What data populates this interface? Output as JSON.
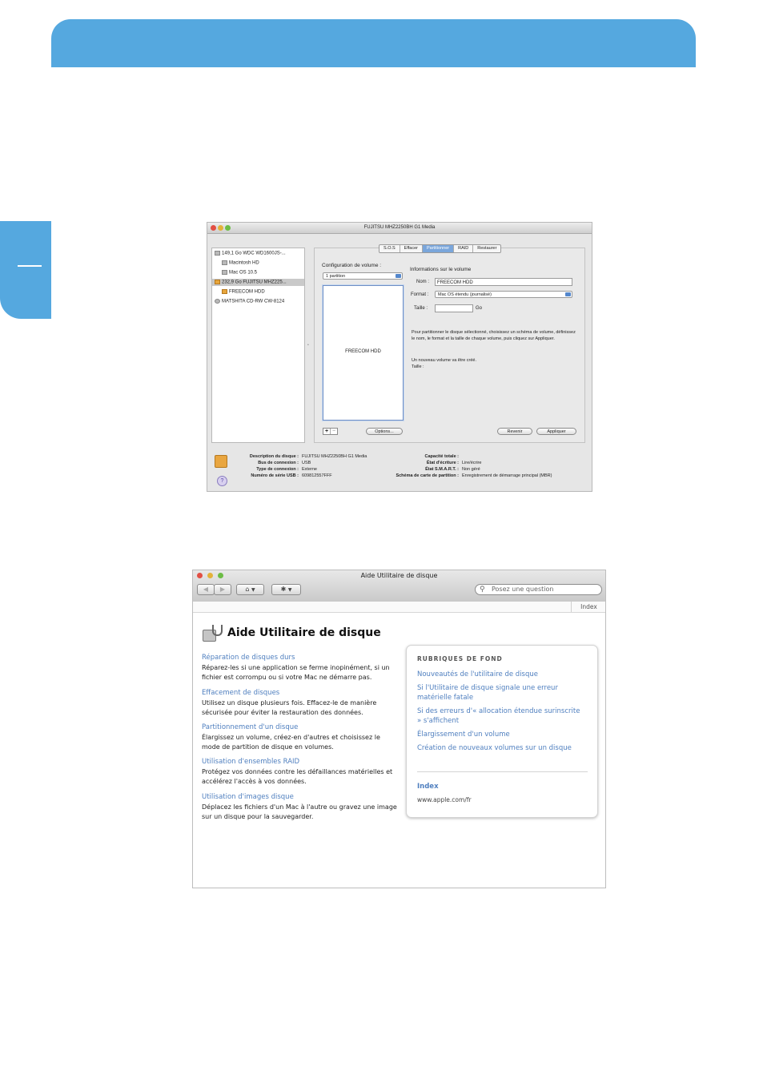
{
  "disk_utility": {
    "title": "FUJITSU MHZ2250BH G1 Media",
    "sidebar": [
      "149,1 Go WDC WD1600JS-...",
      "Macintosh HD",
      "Mac OS 10.5",
      "232,9 Go FUJITSU MHZ225...",
      "FREECOM HDD",
      "MATSHITA CD-RW CW-8124"
    ],
    "tabs": [
      "S.O.S",
      "Effacer",
      "Partitionner",
      "RAID",
      "Restaurer"
    ],
    "config_label": "Configuration de volume :",
    "config_value": "1 partition",
    "volume_name": "FREECOM HDD",
    "info_label": "Informations sur le volume",
    "name_label": "Nom :",
    "name_value": "FREECOM HDD",
    "format_label": "Format :",
    "format_value": "Mac OS étendu (journalisé)",
    "size_label": "Taille :",
    "size_unit": "Go",
    "help_text_1": "Pour partitionner le disque sélectionné, choisissez un schéma de volume, définissez le nom, le format et la taille de chaque volume, puis cliquez sur Appliquer.",
    "help_text_2": "Un nouveau volume va être créé.",
    "help_text_3": "Taille :",
    "plus": "+",
    "minus": "−",
    "options_btn": "Options...",
    "revert_btn": "Revenir",
    "apply_btn": "Appliquer",
    "info_left": [
      {
        "label": "Description du disque :",
        "value": "FUJITSU MHZ2250BH G1 Media"
      },
      {
        "label": "Bus de connexion :",
        "value": "USB"
      },
      {
        "label": "Type de connexion :",
        "value": "Externe"
      },
      {
        "label": "Numéro de série USB :",
        "value": "609812557FFF"
      }
    ],
    "info_right": [
      {
        "label": "Capacité totale :",
        "value": ""
      },
      {
        "label": "État d'écriture :",
        "value": "Lire/écrire"
      },
      {
        "label": "État S.M.A.R.T. :",
        "value": "Non géré"
      },
      {
        "label": "Schéma de carte de partition :",
        "value": "Enregistrement de démarrage principal (MBR)"
      }
    ],
    "help_icon": "?"
  },
  "help_window": {
    "title": "Aide Utilitaire de disque",
    "search_placeholder": "Posez une question",
    "index_tab": "Index",
    "heading": "Aide Utilitaire de disque",
    "topics": [
      {
        "title": "Réparation de disques durs",
        "desc": "Réparez-les si une application se ferme inopinément, si un fichier est corrompu ou si votre Mac ne démarre pas."
      },
      {
        "title": "Effacement de disques",
        "desc": "Utilisez un disque plusieurs fois. Effacez-le de manière sécurisée pour éviter la restauration des données."
      },
      {
        "title": "Partitionnement d'un disque",
        "desc": "Élargissez un volume, créez-en d'autres et choisissez le mode de partition de disque en volumes."
      },
      {
        "title": "Utilisation d'ensembles RAID",
        "desc": "Protégez vos données contre les défaillances matérielles et accélérez l'accès à vos données."
      },
      {
        "title": "Utilisation d'images disque",
        "desc": "Déplacez les fichiers d'un Mac à l'autre ou gravez une image sur un disque pour la sauvegarder."
      }
    ],
    "background_heading": "RUBRIQUES DE FOND",
    "background_links": [
      "Nouveautés de l'utilitaire de disque",
      "Si l'Utilitaire de disque signale une erreur matérielle fatale",
      "Si des erreurs d'« allocation étendue surinscrite » s'affichent",
      "Élargissement d'un volume",
      "Création de nouveaux volumes sur un disque"
    ],
    "index_link": "Index",
    "site": "www.apple.com/fr"
  }
}
